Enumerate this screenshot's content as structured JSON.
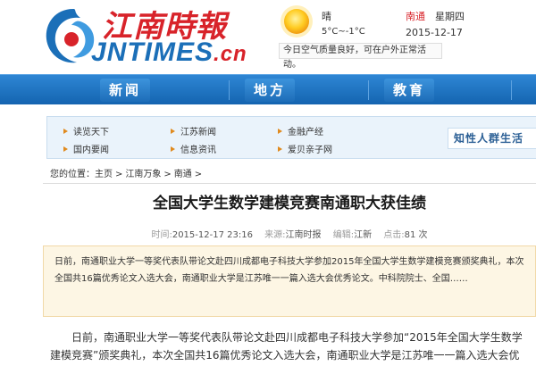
{
  "logo": {
    "chinese": "江南時報",
    "english": "JNTIMES",
    "domain": ".cn"
  },
  "weather": {
    "condition": "晴",
    "temperature": "5°C~-1°C",
    "city": "南通",
    "weekday": "星期四",
    "date": "2015-12-17",
    "air_quality": "今日空气质量良好，可在户外正常活动。",
    "icon": "sun-icon"
  },
  "nav": {
    "items": [
      {
        "label": "新闻"
      },
      {
        "label": "地方"
      },
      {
        "label": "教育"
      }
    ]
  },
  "subnav": {
    "links": [
      {
        "label": "读览天下"
      },
      {
        "label": "江苏新闻"
      },
      {
        "label": "金融产经"
      },
      {
        "label": "国内要闻"
      },
      {
        "label": "信息资讯"
      },
      {
        "label": "爱贝亲子网"
      }
    ],
    "promo": "知性人群生活"
  },
  "breadcrumb": {
    "prefix": "您的位置：",
    "items": [
      {
        "label": "主页"
      },
      {
        "label": "江南万象"
      },
      {
        "label": "南通"
      }
    ],
    "separator": ">"
  },
  "article": {
    "title": "全国大学生数学建模竞赛南通职大获佳绩",
    "time_label": "时间:",
    "time": "2015-12-17 23:16",
    "source_label": "来源:",
    "source": "江南时报",
    "editor_label": "编辑:",
    "editor": "江新",
    "clicks_label": "点击:",
    "clicks": "81 次",
    "summary": "日前，南通职业大学一等奖代表队带论文赴四川成都电子科技大学参加2015年全国大学生数学建模竞赛颁奖典礼，本次全国共16篇优秀论文入选大会，南通职业大学是江苏唯一一篇入选大会优秀论文。中科院院士、全国……",
    "body": "日前，南通职业大学一等奖代表队带论文赴四川成都电子科技大学参加“2015年全国大学生数学建模竞赛”颁奖典礼，本次全国共16篇优秀论文入选大会，南通职业大学是江苏唯一一篇入选大会优"
  },
  "colors": {
    "brand_red": "#d8232a",
    "brand_blue": "#1b6fb8",
    "nav_blue": "#1e72bf",
    "subnav_bg": "#eaf3fb",
    "summary_bg": "#fdf6e4"
  }
}
